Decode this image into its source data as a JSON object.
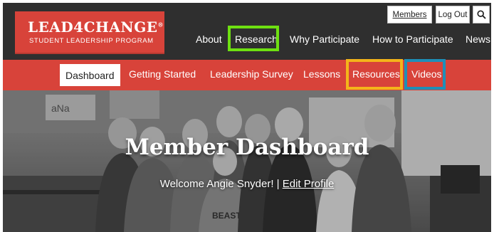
{
  "logo": {
    "title": "LEAD4CHANGE",
    "subtitle": "STUDENT LEADERSHIP PROGRAM"
  },
  "utility": {
    "members": "Members",
    "logout": "Log Out",
    "search_icon": "search-icon"
  },
  "main_nav": [
    {
      "label": "About"
    },
    {
      "label": "Research"
    },
    {
      "label": "Why Participate"
    },
    {
      "label": "How to Participate"
    },
    {
      "label": "News"
    }
  ],
  "sub_nav": [
    {
      "label": "Dashboard",
      "active": true
    },
    {
      "label": "Getting Started"
    },
    {
      "label": "Leadership Survey"
    },
    {
      "label": "Lessons"
    },
    {
      "label": "Resources"
    },
    {
      "label": "Videos"
    }
  ],
  "hero": {
    "title": "Member Dashboard",
    "welcome": "Welcome Angie Snyder! | ",
    "edit_profile": "Edit Profile"
  },
  "photo_text": {
    "board_top": "aNa",
    "shirt": "BEAST SQUAD"
  },
  "colors": {
    "brand_red": "#d8433a",
    "dark_bar": "#2f2f2f",
    "highlight_green": "#6ee011",
    "highlight_orange": "#f4b41a",
    "highlight_blue": "#1e8fb8"
  }
}
